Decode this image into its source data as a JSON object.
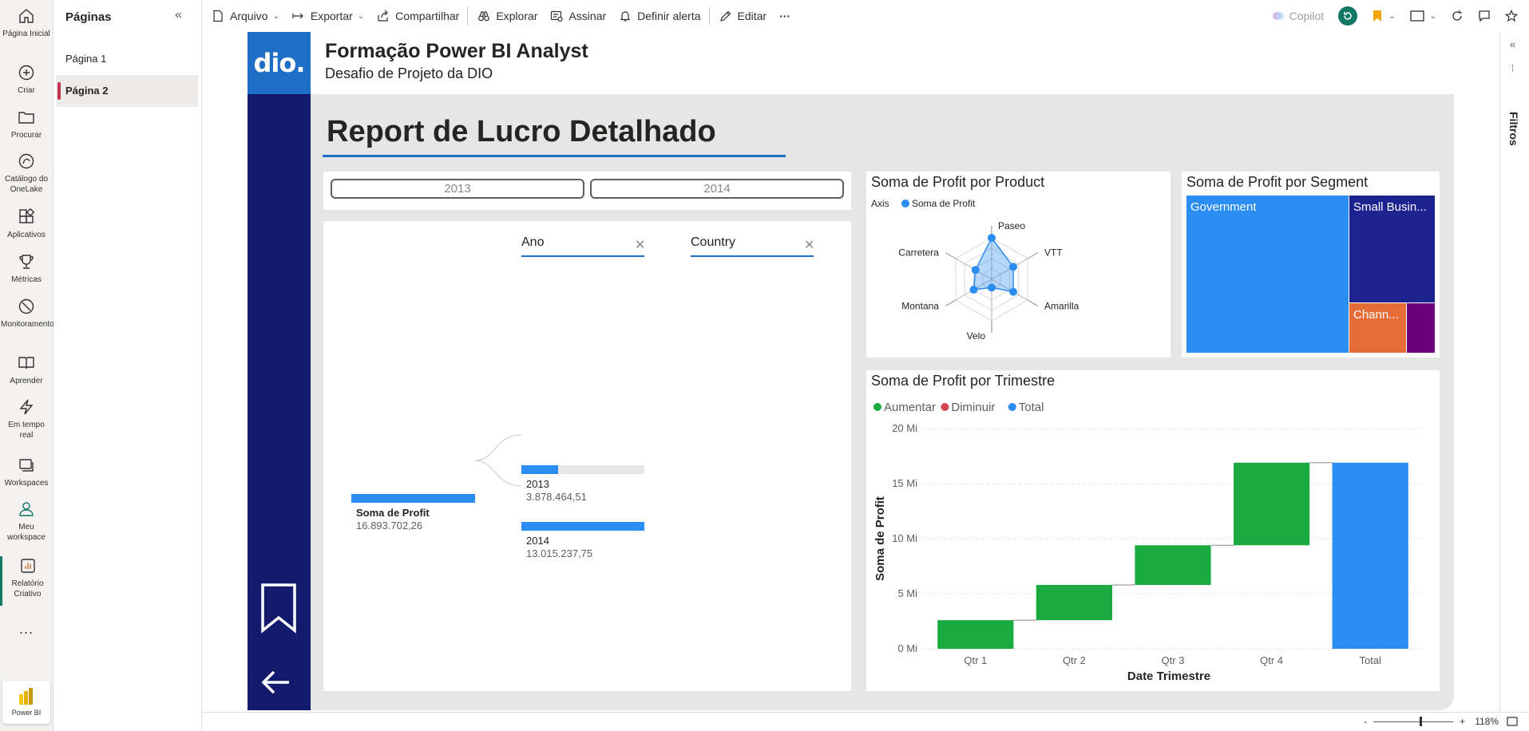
{
  "leftnav": {
    "items": [
      {
        "label": "Página Inicial",
        "icon": "home-icon"
      },
      {
        "label": "Criar",
        "icon": "plus-circle-icon"
      },
      {
        "label": "Procurar",
        "icon": "folder-icon"
      },
      {
        "label": "Catálogo do OneLake",
        "icon": "onelake-icon"
      },
      {
        "label": "Aplicativos",
        "icon": "apps-icon"
      },
      {
        "label": "Métricas",
        "icon": "trophy-icon"
      },
      {
        "label": "Monitoramento",
        "icon": "monitor-icon"
      },
      {
        "label": "Aprender",
        "icon": "book-icon"
      },
      {
        "label": "Em tempo real",
        "icon": "lightning-icon"
      },
      {
        "label": "Workspaces",
        "icon": "workspaces-icon"
      },
      {
        "label": "Meu workspace",
        "icon": "person-icon"
      },
      {
        "label": "Relatório Criativo",
        "icon": "report-icon"
      }
    ],
    "more": "...",
    "app_name": "Power BI"
  },
  "pages_pane": {
    "title": "Páginas",
    "items": [
      "Página 1",
      "Página 2"
    ],
    "active_index": 1
  },
  "toolbar": {
    "arquivo": "Arquivo",
    "exportar": "Exportar",
    "compartilhar": "Compartilhar",
    "explorar": "Explorar",
    "assinar": "Assinar",
    "definir_alerta": "Definir alerta",
    "editar": "Editar",
    "more": "···",
    "copilot": "Copilot"
  },
  "report": {
    "logo_text": "dio.",
    "header_title": "Formação Power BI Analyst",
    "header_subtitle": "Desafio de Projeto da DIO",
    "title": "Report de Lucro Detalhado",
    "slicer": {
      "options": [
        "2013",
        "2014"
      ]
    },
    "decomposition": {
      "fields": [
        "Ano",
        "Country"
      ],
      "root": {
        "label": "Soma de Profit",
        "value": "16.893.702,26"
      },
      "children": [
        {
          "label": "2013",
          "value": "3.878.464,51",
          "fraction": 0.23
        },
        {
          "label": "2014",
          "value": "13.015.237,75",
          "fraction": 0.77
        }
      ]
    }
  },
  "filters": {
    "label": "Filtros"
  },
  "zoom": {
    "minus": "-",
    "plus": "+",
    "level": "118%"
  },
  "chart_data": [
    {
      "type": "radar",
      "title": "Soma de Profit por Product",
      "legend_title": "Axis",
      "series": [
        {
          "name": "Soma de Profit",
          "color": "#2b8cf2",
          "values": [
            1.0,
            0.6,
            0.6,
            0.2,
            0.5,
            0.45
          ]
        }
      ],
      "categories": [
        "Paseo",
        "VTT",
        "Amarilla",
        "Velo",
        "Montana",
        "Carretera"
      ]
    },
    {
      "type": "treemap",
      "title": "Soma de Profit por Segment",
      "categories": [
        "Government",
        "Small Busin...",
        "Chann...",
        ""
      ],
      "values": [
        11.4,
        4.6,
        1.3,
        0.6
      ],
      "colors": [
        "#2b8cf2",
        "#1c2391",
        "#e66c37",
        "#6b007b"
      ]
    },
    {
      "type": "waterfall",
      "title": "Soma de Profit por Trimestre",
      "legend": [
        {
          "name": "Aumentar",
          "color": "#1aab40"
        },
        {
          "name": "Diminuir",
          "color": "#d64554"
        },
        {
          "name": "Total",
          "color": "#2b8cf2"
        }
      ],
      "categories": [
        "Qtr 1",
        "Qtr 2",
        "Qtr 3",
        "Qtr 4",
        "Total"
      ],
      "values": [
        2.6,
        3.2,
        3.6,
        7.5,
        16.9
      ],
      "xlabel": "Date Trimestre",
      "ylabel": "Soma de Profit",
      "yticks": [
        "0 Mi",
        "5 Mi",
        "10 Mi",
        "15 Mi",
        "20 Mi"
      ],
      "ylim": [
        0,
        20
      ]
    }
  ]
}
